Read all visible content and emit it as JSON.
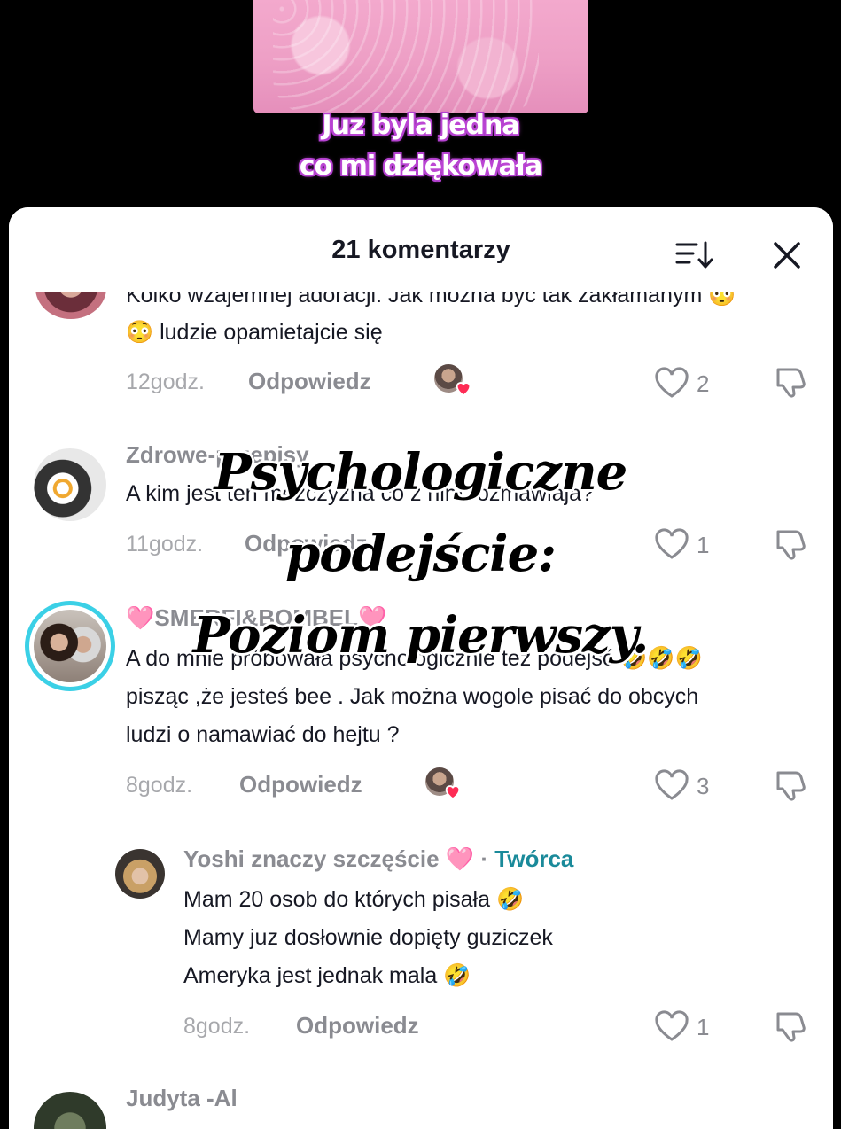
{
  "video": {
    "caption_line1": "Juz byla jedna",
    "caption_line2": "co mi dziękowała"
  },
  "comments_panel": {
    "title": "21 komentarzy",
    "icons": {
      "sort": "sort-icon",
      "close": "close-icon"
    }
  },
  "comments": [
    {
      "text_line1": "Kolko wzajemnej adoracji. Jak można być tak zakłamanym 😳",
      "text_line2": "😳 ludzie opamietajcie się",
      "time": "12godz.",
      "reply": "Odpowiedz",
      "likes": "2"
    },
    {
      "username": "Zdrowe-przepisy",
      "text_line1": "A kim jest ten mezczyzna co z nim rozmawiaja?",
      "time": "11godz.",
      "reply": "Odpowiedz",
      "likes": "1"
    },
    {
      "username": "🩷SMERFI&BOMBEL🩷",
      "text_line1": "A do mnie próbowała psychologicznie też podejść 🤣🤣🤣",
      "text_line2": "pisząc ,że jesteś bee . Jak można wogole pisać do obcych",
      "text_line3": "ludzi o namawiać do hejtu ?",
      "time": "8godz.",
      "reply": "Odpowiedz",
      "likes": "3"
    },
    {
      "username": "Yoshi znaczy szczęście 🩷",
      "badge_sep": " · ",
      "badge": "Twórca",
      "text_line1": "Mam 20 osob do których pisała 🤣",
      "text_line2": "Mamy juz dosłownie dopięty guziczek",
      "text_line3": "Ameryka jest jednak mala 🤣",
      "time": "8godz.",
      "reply": "Odpowiedz",
      "likes": "1"
    },
    {
      "username": "Judyta -Al"
    }
  ],
  "overlay_text": {
    "line1": "Psychologiczne",
    "line2": "podejście:",
    "line3": "Poziom pierwszy."
  },
  "colors": {
    "creator_badge": "#1a8a9a",
    "caption_glow": "#c14bd6",
    "heart_badge": "#fe2c55"
  }
}
